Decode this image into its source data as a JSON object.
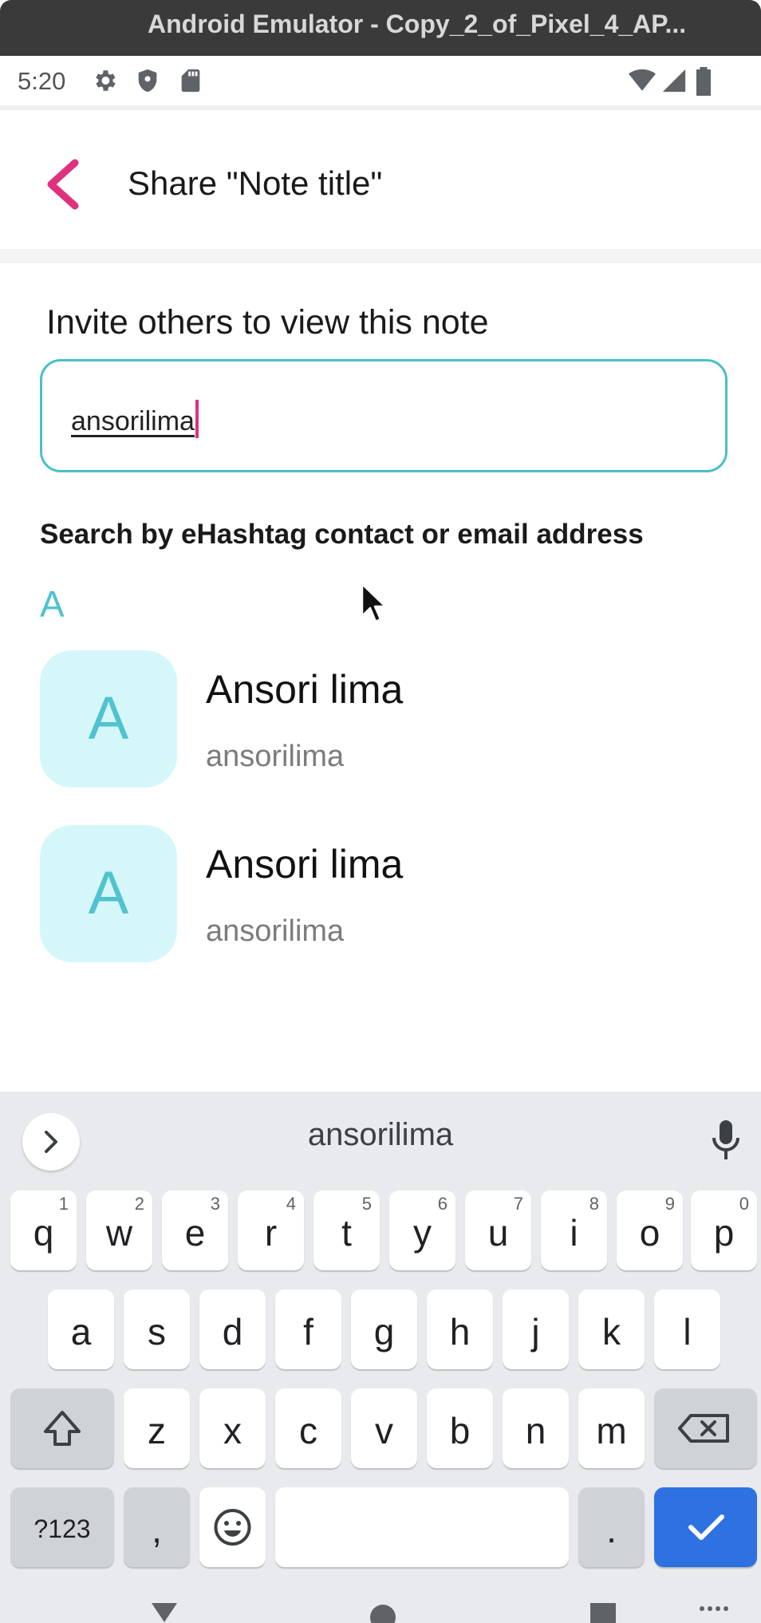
{
  "emulator": {
    "title": "Android Emulator - Copy_2_of_Pixel_4_AP..."
  },
  "status_bar": {
    "time": "5:20",
    "left_icons": [
      "settings-icon",
      "shield-icon",
      "sd-card-icon"
    ],
    "right_icons": [
      "wifi-icon",
      "signal-icon",
      "battery-icon"
    ]
  },
  "app_bar": {
    "title": "Share \"Note title\"",
    "back_icon": "chevron-left-icon",
    "accent": "#e0317e"
  },
  "invite": {
    "heading": "Invite others to view this note",
    "input_value": "ansorilima",
    "hint": "Search by eHashtag contact or email address",
    "accent": "#49bfca"
  },
  "results": {
    "section_letter": "A",
    "contacts": [
      {
        "initial": "A",
        "name": "Ansori lima",
        "username": "ansorilima"
      },
      {
        "initial": "A",
        "name": "Ansori lima",
        "username": "ansorilima"
      }
    ]
  },
  "keyboard": {
    "suggestion": "ansorilima",
    "row1": [
      {
        "k": "q",
        "h": "1"
      },
      {
        "k": "w",
        "h": "2"
      },
      {
        "k": "e",
        "h": "3"
      },
      {
        "k": "r",
        "h": "4"
      },
      {
        "k": "t",
        "h": "5"
      },
      {
        "k": "y",
        "h": "6"
      },
      {
        "k": "u",
        "h": "7"
      },
      {
        "k": "i",
        "h": "8"
      },
      {
        "k": "o",
        "h": "9"
      },
      {
        "k": "p",
        "h": "0"
      }
    ],
    "row2": [
      "a",
      "s",
      "d",
      "f",
      "g",
      "h",
      "j",
      "k",
      "l"
    ],
    "row3": [
      "z",
      "x",
      "c",
      "v",
      "b",
      "n",
      "m"
    ],
    "symbols_label": "?123",
    "comma_label": ",",
    "period_label": ".",
    "enter_color": "#2d72e0"
  }
}
